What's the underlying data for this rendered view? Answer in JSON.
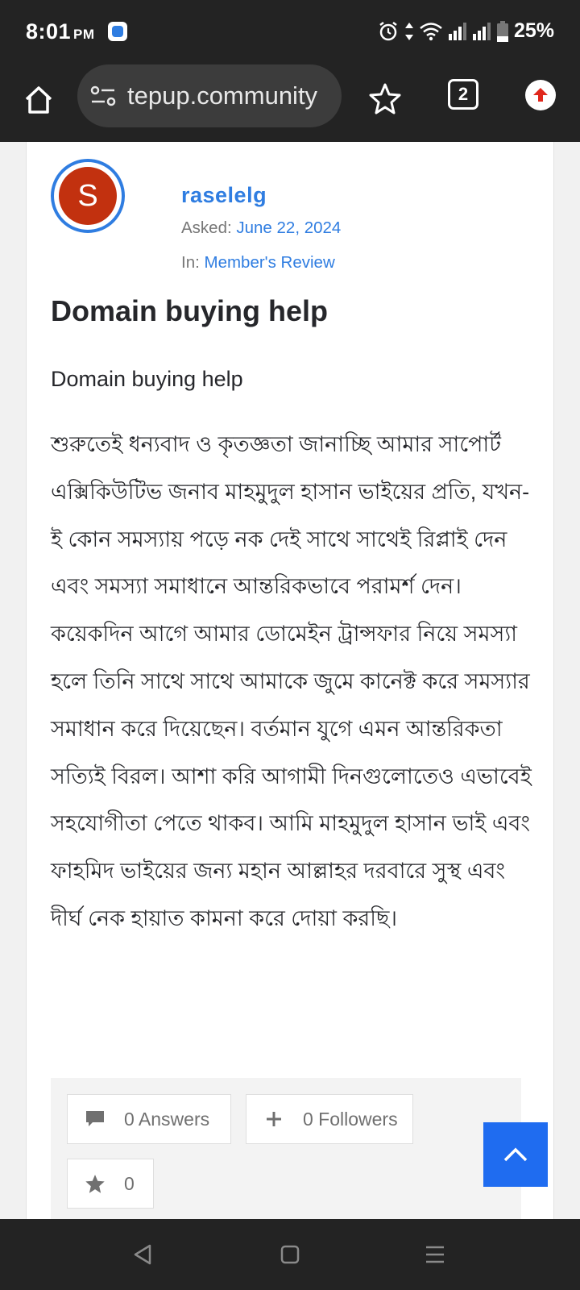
{
  "status_bar": {
    "time": "8:01",
    "ampm": "PM",
    "battery": "25%"
  },
  "browser": {
    "url": "tepup.community",
    "tab_count": "2"
  },
  "question": {
    "author_initial": "S",
    "author": "raselelg",
    "asked_label": "Asked:",
    "asked_date": "June 22, 2024",
    "in_label": "In:",
    "category": "Member's Review",
    "title": "Domain buying help",
    "subtitle": "Domain buying help",
    "body": "শুরুতেই ধন্যবাদ ও কৃতজ্ঞতা জানাচ্ছি আমার সাপোর্ট এক্সিকিউটিভ জনাব মাহমুদুল হাসান ভাইয়ের প্রতি, যখন-ই কোন সমস্যায় পড়ে নক দেই সাথে সাথেই রিপ্লাই দেন এবং সমস্যা সমাধানে আন্তরিকভাবে পরামর্শ দেন। কয়েকদিন আগে আমার ডোমেইন ট্রান্সফার নিয়ে সমস্যা হলে তিনি সাথে সাথে আমাকে জুমে কানেক্ট করে সমস্যার সমাধান করে দিয়েছেন। বর্তমান যুগে এমন আন্তরিকতা সত্যিই বিরল। আশা করি আগামী দিনগুলোতেও এভাবেই সহযোগীতা পেতে থাকব। আমি মাহমুদুল হাসান ভাই এবং ফাহমিদ ভাইয়ের জন্য মহান আল্লাহর দরবারে সুস্থ এবং দীর্ঘ নেক হায়াত কামনা করে দোয়া করছি।"
  },
  "actions": {
    "answers_label": "0 Answers",
    "followers_label": "0 Followers",
    "star_count": "0"
  },
  "colors": {
    "accent": "#2f7de1",
    "avatar_bg": "#c2310f",
    "scroll_top_bg": "#1f6cf0",
    "system_bar": "#232323"
  },
  "icons": [
    "home-icon",
    "site-settings-icon",
    "star-outline-icon",
    "tabs-icon",
    "update-icon",
    "comment-icon",
    "plus-icon",
    "star-icon",
    "chevron-up-icon",
    "back-icon",
    "home-square-icon",
    "recents-icon"
  ]
}
